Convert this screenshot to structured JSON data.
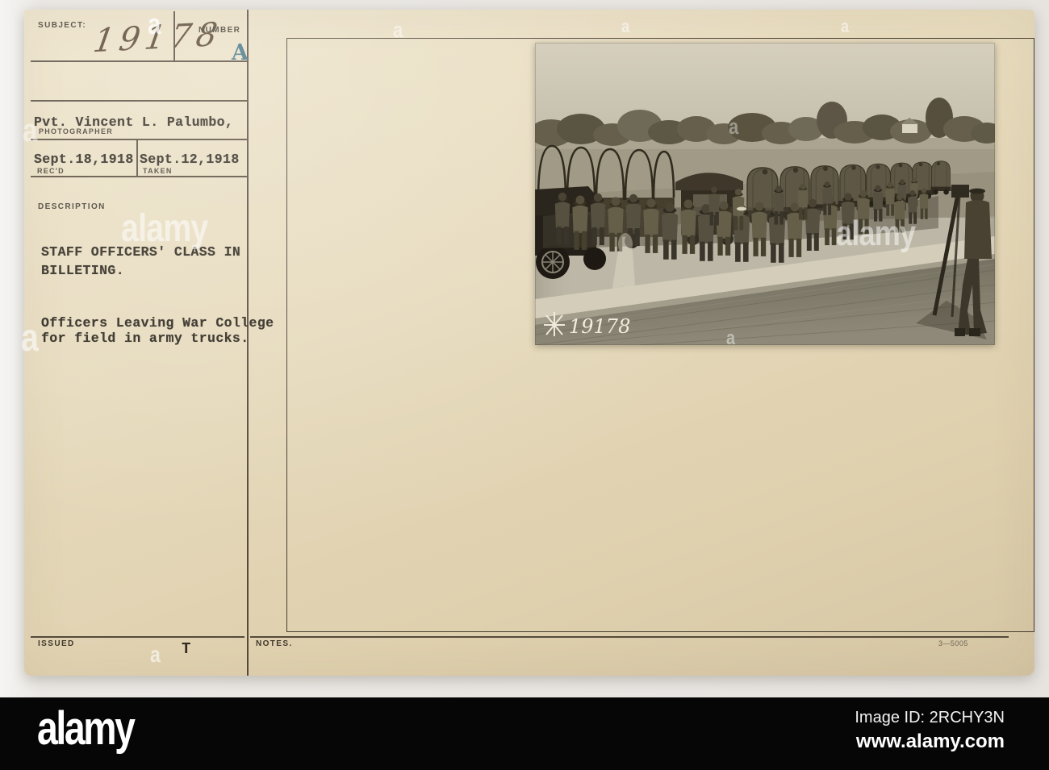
{
  "card": {
    "subject_label": "SUBJECT:",
    "subject_value": "19178",
    "number_label": "NUMBER",
    "number_value": "A",
    "photographer_name": "Pvt. Vincent L. Palumbo,",
    "photographer_label": "PHOTOGRAPHER",
    "recd_date": "Sept.18,1918",
    "recd_label": "REC'D",
    "taken_date": "Sept.12,1918",
    "taken_label": "TAKEN",
    "description_label": "DESCRIPTION",
    "description_line1": "STAFF OFFICERS' CLASS IN",
    "description_line2": "BILLETING.",
    "caption_line1": "Officers Leaving War College",
    "caption_line2": "for field in army trucks.",
    "issued_label": "ISSUED",
    "issued_value": "T",
    "notes_label": "NOTES.",
    "form_number": "3—5005",
    "accent_blue": "#3e7083",
    "paper_color": "#e6dabc",
    "ink_color": "#2c261c"
  },
  "photo": {
    "photo_number": "19178",
    "insignia": "crossed-signal-flags-icon",
    "scene": "Officers leaving War College boarding army trucks beside a field"
  },
  "watermarks": {
    "brand": "alamy",
    "a_glyph": "a"
  },
  "footer": {
    "brand": "alamy",
    "image_id_text": "Image ID: 2RCHY3N",
    "website": "www.alamy.com"
  }
}
